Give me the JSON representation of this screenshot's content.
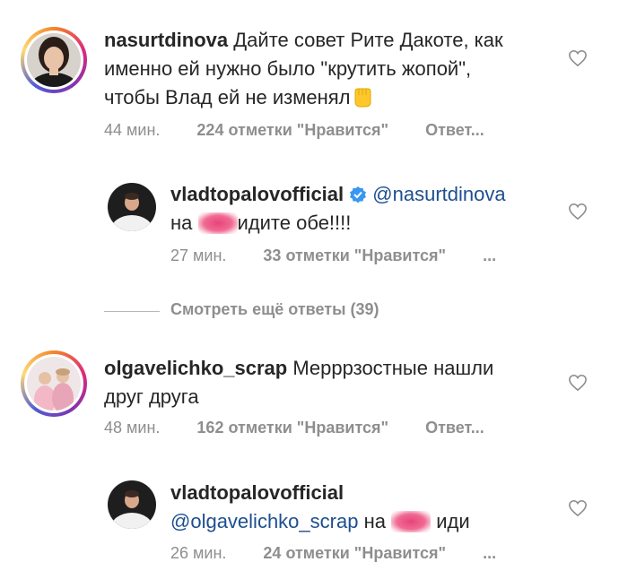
{
  "comments": [
    {
      "username": "nasurtdinova",
      "text": "Дайте совет Рите Дакоте, как именно ей нужно было \"крутить жопой\", чтобы Влад ей не изменял",
      "time": "44 мин.",
      "likes": "224 отметки \"Нравится\"",
      "reply": "Ответ..."
    },
    {
      "username": "vladtopalovofficial",
      "mention": "@nasurtdinova",
      "text_before": "на",
      "text_after": "идите обе!!!!",
      "time": "27 мин.",
      "likes": "33 отметки \"Нравится\"",
      "more": "..."
    },
    {
      "username": "olgavelichko_scrap",
      "text": "Мерррзостные нашли друг друга",
      "time": "48 мин.",
      "likes": "162 отметки \"Нравится\"",
      "reply": "Ответ..."
    },
    {
      "username": "vladtopalovofficial",
      "mention": "@olgavelichko_scrap",
      "text_before": "на",
      "text_after": "иди",
      "time": "26 мин.",
      "likes": "24 отметки \"Нравится\"",
      "more": "..."
    }
  ],
  "view_more": "Смотреть ещё ответы (39)",
  "colors": {
    "mention": "#1d4f8f",
    "meta": "#8e8e8e",
    "verified": "#3897f0"
  }
}
